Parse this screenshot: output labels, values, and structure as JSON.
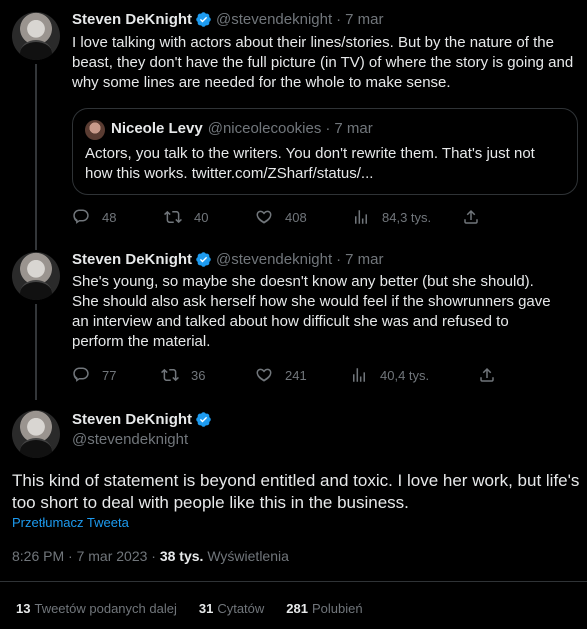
{
  "tweet1": {
    "name": "Steven DeKnight",
    "handle": "@stevendeknight",
    "time": "7 mar",
    "text": "I love talking with actors about their lines/stories. But by the nature of the beast, they don't have the full picture (in TV) of where the story is going and why some lines are needed for the whole to make sense.",
    "quote": {
      "name": "Niceole Levy",
      "handle": "@niceolecookies",
      "time": "7 mar",
      "text": "Actors, you talk to the writers. You don't rewrite them. That's just not how this works. twitter.com/ZSharf/status/..."
    },
    "replies": "48",
    "retweets": "40",
    "likes": "408",
    "views": "84,3 tys."
  },
  "tweet2": {
    "name": "Steven DeKnight",
    "handle": "@stevendeknight",
    "time": "7 mar",
    "text": "She's young, so maybe she doesn't know any better (but she should). She should also ask herself how she would feel if the showrunners gave an interview and talked about how difficult she was and refused to perform the material.",
    "replies": "77",
    "retweets": "36",
    "likes": "241",
    "views": "40,4 tys."
  },
  "main": {
    "name": "Steven DeKnight",
    "handle": "@stevendeknight",
    "text": "This kind of statement is beyond entitled and toxic. I love her work, but life's too short to deal with people like this in the business.",
    "translate": "Przetłumacz Tweeta",
    "timestamp": "8:26 PM · 7 mar 2023 · ",
    "views_count": "38 tys.",
    "views_label": " Wyświetlenia",
    "retweets_count": "13",
    "retweets_label": "Tweetów podanych dalej",
    "quotes_count": "31",
    "quotes_label": "Cytatów",
    "likes_count": "281",
    "likes_label": "Polubień"
  },
  "colors": {
    "background": "#000000",
    "text": "#e7e9ea",
    "muted": "#71767b",
    "link": "#1d9bf0",
    "border": "#2f3336"
  }
}
